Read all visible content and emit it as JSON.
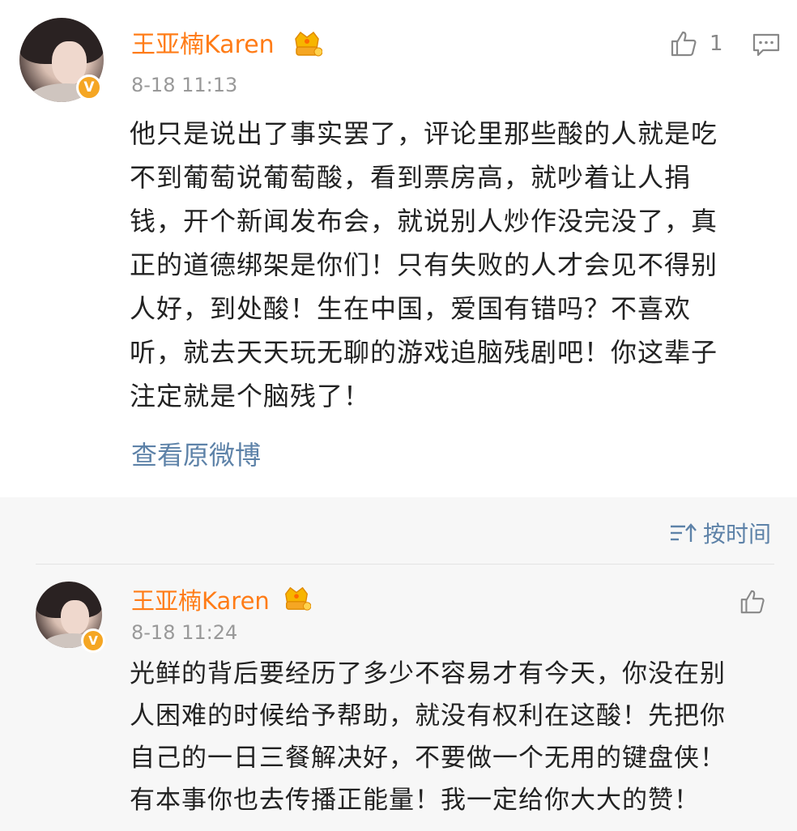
{
  "post": {
    "author": "王亚楠Karen",
    "time": "8-18 11:13",
    "like_count": "1",
    "lines": [
      "他只是说出了事实罢了，评论里那些酸的人就是吃",
      "不到葡萄说葡萄酸，看到票房高，就吵着让人捐",
      "钱，开个新闻发布会，就说别人炒作没完没了，真",
      "正的道德绑架是你们！只有失败的人才会见不得别",
      "人好，到处酸！生在中国，爱国有错吗？不喜欢",
      "听，就去天天玩无聊的游戏追脑残剧吧！你这辈子",
      "注定就是个脑残了！"
    ],
    "view_original": "查看原微博"
  },
  "sort": {
    "label": "按时间"
  },
  "reply": {
    "author": "王亚楠Karen",
    "time": "8-18 11:24",
    "lines": [
      "光鲜的背后要经历了多少不容易才有今天，你没在别",
      "人困难的时候给予帮助，就没有权利在这酸！先把你",
      "自己的一日三餐解决好，不要做一个无用的键盘侠！",
      "有本事你也去传播正能量！我一定给你大大的赞！"
    ]
  },
  "icons": {
    "verified": "verified-v-icon",
    "crown": "crown-badge-icon",
    "like": "thumbs-up-icon",
    "comment": "comment-icon",
    "sort": "sort-icon"
  },
  "colors": {
    "name": "#ff7c17",
    "link": "#5d82a8",
    "timestamp": "#999999",
    "verified": "#f5a623",
    "gray_bg": "#f7f7f7"
  }
}
